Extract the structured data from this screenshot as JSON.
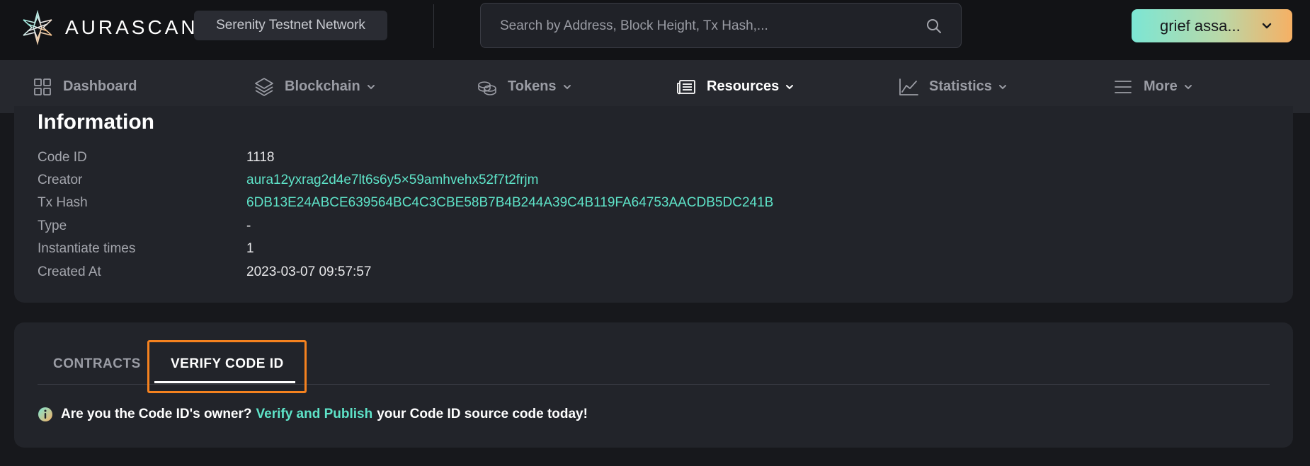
{
  "header": {
    "logo_text": "AURASCAN",
    "network": "Serenity Testnet Network",
    "search_placeholder": "Search by Address, Block Height, Tx Hash,...",
    "wallet_label": "grief assa..."
  },
  "nav": {
    "items": [
      {
        "label": "Dashboard",
        "icon": "dashboard-grid-icon",
        "has_dropdown": false
      },
      {
        "label": "Blockchain",
        "icon": "layers-icon",
        "has_dropdown": true
      },
      {
        "label": "Tokens",
        "icon": "coins-icon",
        "has_dropdown": true
      },
      {
        "label": "Resources",
        "icon": "newspaper-icon",
        "has_dropdown": true,
        "active": true
      },
      {
        "label": "Statistics",
        "icon": "line-chart-icon",
        "has_dropdown": true
      },
      {
        "label": "More",
        "icon": "menu-icon",
        "has_dropdown": true
      }
    ]
  },
  "info": {
    "title": "Information",
    "rows": [
      {
        "label": "Code ID",
        "value": "1118",
        "link": false
      },
      {
        "label": "Creator",
        "value": "aura12yxrag2d4e7lt6s6y5×59amhvehx52f7t2frjm",
        "link": true
      },
      {
        "label": "Tx Hash",
        "value": "6DB13E24ABCE639564BC4C3CBE58B7B4B244A39C4B119FA64753AACDB5DC241B",
        "link": true
      },
      {
        "label": "Type",
        "value": "-",
        "link": false
      },
      {
        "label": "Instantiate times",
        "value": "1",
        "link": false
      },
      {
        "label": "Created At",
        "value": "2023-03-07 09:57:57",
        "link": false
      }
    ]
  },
  "tabs": {
    "items": [
      {
        "label": "CONTRACTS",
        "active": false
      },
      {
        "label": "VERIFY CODE ID",
        "active": true
      }
    ]
  },
  "notice": {
    "prefix": "Are you the Code ID's owner?",
    "link": "Verify and Publish",
    "suffix": "your Code ID source code today!"
  },
  "colors": {
    "accent": "#5ee3c8",
    "highlight": "#f5821f",
    "background": "#17181c",
    "card": "#22242a"
  }
}
